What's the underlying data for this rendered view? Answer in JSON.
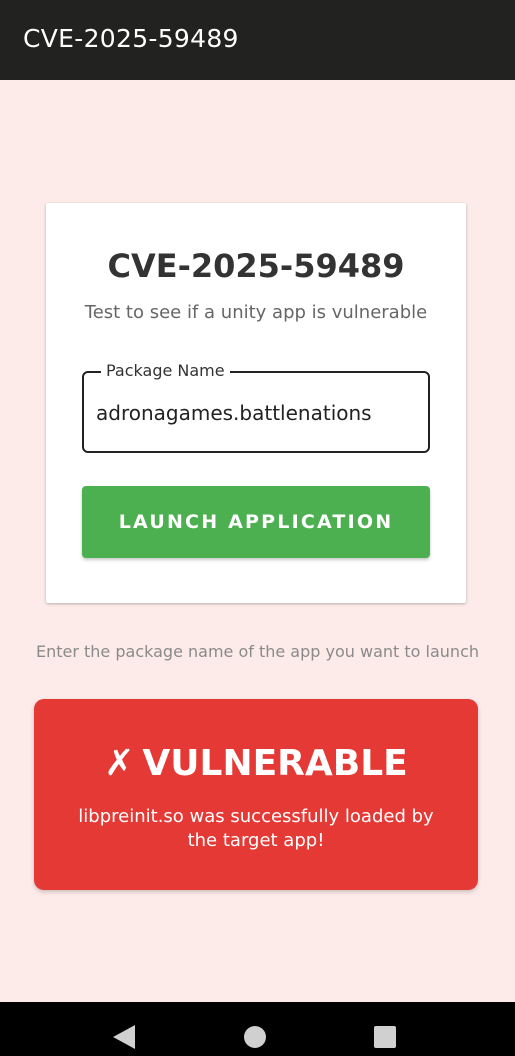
{
  "app_bar": {
    "title": "CVE-2025-59489"
  },
  "card": {
    "title": "CVE-2025-59489",
    "subtitle": "Test to see if a unity app is vulnerable",
    "package_field": {
      "label": "Package Name",
      "value": "adronagames.battlenations"
    },
    "launch_button_label": "LAUNCH APPLICATION"
  },
  "hint": "Enter the package name of the app you want to launch",
  "result": {
    "mark": "✗",
    "status": "VULNERABLE",
    "message": "libpreinit.so was successfully loaded by the target app!"
  },
  "colors": {
    "background": "#FDEBEA",
    "app_bar": "#222220",
    "launch_button": "#4CAF50",
    "result_card": "#E53935",
    "nav_bar": "#000000"
  },
  "icons": {
    "nav_back": "back-triangle-icon",
    "nav_home": "home-circle-icon",
    "nav_recent": "recents-square-icon"
  }
}
